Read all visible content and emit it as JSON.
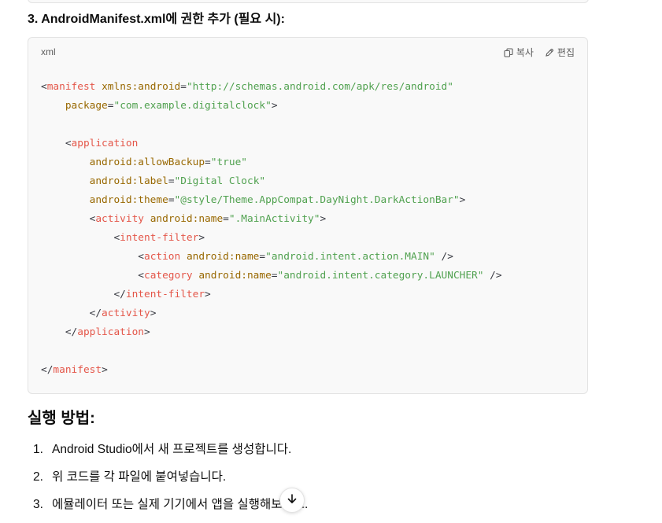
{
  "step_heading": "3. AndroidManifest.xml에 권한 추가 (필요 시):",
  "code_block": {
    "language": "xml",
    "copy_label": "복사",
    "edit_label": "편집",
    "copy_icon": "copy-icon",
    "edit_icon": "pencil-icon",
    "lines": [
      [
        [
          "pun",
          "<"
        ],
        [
          "tag",
          "manifest"
        ],
        [
          "pun",
          " "
        ],
        [
          "attr",
          "xmlns:android"
        ],
        [
          "pun",
          "="
        ],
        [
          "str",
          "\"http://schemas.android.com/apk/res/android\""
        ]
      ],
      [
        [
          "pun",
          "    "
        ],
        [
          "attr",
          "package"
        ],
        [
          "pun",
          "="
        ],
        [
          "str",
          "\"com.example.digitalclock\""
        ],
        [
          "pun",
          ">"
        ]
      ],
      [],
      [
        [
          "pun",
          "    <"
        ],
        [
          "tag",
          "application"
        ]
      ],
      [
        [
          "pun",
          "        "
        ],
        [
          "attr",
          "android:allowBackup"
        ],
        [
          "pun",
          "="
        ],
        [
          "str",
          "\"true\""
        ]
      ],
      [
        [
          "pun",
          "        "
        ],
        [
          "attr",
          "android:label"
        ],
        [
          "pun",
          "="
        ],
        [
          "str",
          "\"Digital Clock\""
        ]
      ],
      [
        [
          "pun",
          "        "
        ],
        [
          "attr",
          "android:theme"
        ],
        [
          "pun",
          "="
        ],
        [
          "str",
          "\"@style/Theme.AppCompat.DayNight.DarkActionBar\""
        ],
        [
          "pun",
          ">"
        ]
      ],
      [
        [
          "pun",
          "        <"
        ],
        [
          "tag",
          "activity"
        ],
        [
          "pun",
          " "
        ],
        [
          "attr",
          "android:name"
        ],
        [
          "pun",
          "="
        ],
        [
          "str",
          "\".MainActivity\""
        ],
        [
          "pun",
          ">"
        ]
      ],
      [
        [
          "pun",
          "            <"
        ],
        [
          "tag",
          "intent-filter"
        ],
        [
          "pun",
          ">"
        ]
      ],
      [
        [
          "pun",
          "                <"
        ],
        [
          "tag",
          "action"
        ],
        [
          "pun",
          " "
        ],
        [
          "attr",
          "android:name"
        ],
        [
          "pun",
          "="
        ],
        [
          "str",
          "\"android.intent.action.MAIN\""
        ],
        [
          "pun",
          " />"
        ]
      ],
      [
        [
          "pun",
          "                <"
        ],
        [
          "tag",
          "category"
        ],
        [
          "pun",
          " "
        ],
        [
          "attr",
          "android:name"
        ],
        [
          "pun",
          "="
        ],
        [
          "str",
          "\"android.intent.category.LAUNCHER\""
        ],
        [
          "pun",
          " />"
        ]
      ],
      [
        [
          "pun",
          "            </"
        ],
        [
          "tag",
          "intent-filter"
        ],
        [
          "pun",
          ">"
        ]
      ],
      [
        [
          "pun",
          "        </"
        ],
        [
          "tag",
          "activity"
        ],
        [
          "pun",
          ">"
        ]
      ],
      [
        [
          "pun",
          "    </"
        ],
        [
          "tag",
          "application"
        ],
        [
          "pun",
          ">"
        ]
      ],
      [],
      [
        [
          "pun",
          "</"
        ],
        [
          "tag",
          "manifest"
        ],
        [
          "pun",
          ">"
        ]
      ]
    ]
  },
  "section_heading": "실행 방법:",
  "steps": [
    {
      "num": "1.",
      "text": "Android Studio에서 새 프로젝트를 생성합니다."
    },
    {
      "num": "2.",
      "text": "위 코드를 각 파일에 붙여넣습니다."
    },
    {
      "num": "3.",
      "text": "에뮬레이터 또는 실제 기기에서 앱을 실행해보세요."
    }
  ],
  "scroll_button_icon": "arrow-down-icon",
  "colors": {
    "tag": "#e45649",
    "attribute": "#986801",
    "string": "#50a14f",
    "code_background": "#f9f9f9",
    "border": "#e3e3e3"
  }
}
